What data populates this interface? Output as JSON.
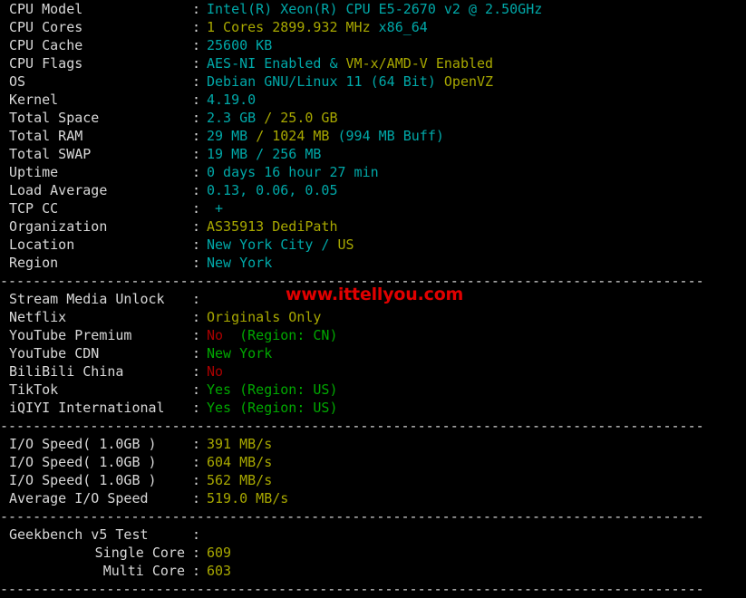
{
  "terminal": {
    "background_color": "#000000",
    "label_color": "#d8d8d8",
    "cyan": "#00a8a8",
    "yellow": "#a8a800",
    "green": "#00a800",
    "red": "#a80000",
    "separator": "--------------------------------------------------------------------------------------"
  },
  "watermark": {
    "text": "www.ittellyou.com",
    "color": "#e00000"
  },
  "system": {
    "rows": [
      {
        "label": "CPU Model",
        "colon": ":",
        "parts": [
          {
            "text": "Intel(R) Xeon(R) CPU E5-2670 v2 @ 2.50GHz",
            "color": "cyan"
          }
        ]
      },
      {
        "label": "CPU Cores",
        "colon": ":",
        "parts": [
          {
            "text": "1 Cores 2899.932 MHz ",
            "color": "yellow"
          },
          {
            "text": "x86_64",
            "color": "cyan"
          }
        ]
      },
      {
        "label": "CPU Cache",
        "colon": ":",
        "parts": [
          {
            "text": "25600 KB",
            "color": "cyan"
          }
        ]
      },
      {
        "label": "CPU Flags",
        "colon": ":",
        "parts": [
          {
            "text": "AES-NI Enabled",
            "color": "cyan"
          },
          {
            "text": " & ",
            "color": "cyan"
          },
          {
            "text": "VM-x/AMD-V Enabled",
            "color": "yellow"
          }
        ]
      },
      {
        "label": "OS",
        "colon": ":",
        "parts": [
          {
            "text": "Debian GNU/Linux 11 (64 Bit) ",
            "color": "cyan"
          },
          {
            "text": "OpenVZ",
            "color": "yellow"
          }
        ]
      },
      {
        "label": "Kernel",
        "colon": ":",
        "parts": [
          {
            "text": "4.19.0",
            "color": "cyan"
          }
        ]
      },
      {
        "label": "Total Space",
        "colon": ":",
        "parts": [
          {
            "text": "2.3 GB ",
            "color": "cyan"
          },
          {
            "text": "/ 25.0 GB",
            "color": "yellow"
          }
        ]
      },
      {
        "label": "Total RAM",
        "colon": ":",
        "parts": [
          {
            "text": "29 MB ",
            "color": "cyan"
          },
          {
            "text": "/ 1024 MB ",
            "color": "yellow"
          },
          {
            "text": "(994 MB Buff)",
            "color": "cyan"
          }
        ]
      },
      {
        "label": "Total SWAP",
        "colon": ":",
        "parts": [
          {
            "text": "19 MB / 256 MB",
            "color": "cyan"
          }
        ]
      },
      {
        "label": "Uptime",
        "colon": ":",
        "parts": [
          {
            "text": "0 days 16 hour 27 min",
            "color": "cyan"
          }
        ]
      },
      {
        "label": "Load Average",
        "colon": ":",
        "parts": [
          {
            "text": "0.13, 0.06, 0.05",
            "color": "cyan"
          }
        ]
      },
      {
        "label": "TCP CC",
        "colon": ":",
        "parts": [
          {
            "text": " +",
            "color": "cyan"
          }
        ]
      },
      {
        "label": "Organization",
        "colon": ":",
        "parts": [
          {
            "text": "AS35913 DediPath",
            "color": "yellow"
          }
        ]
      },
      {
        "label": "Location",
        "colon": ":",
        "parts": [
          {
            "text": "New York City / ",
            "color": "cyan"
          },
          {
            "text": "US",
            "color": "yellow"
          }
        ]
      },
      {
        "label": "Region",
        "colon": ":",
        "parts": [
          {
            "text": "New York",
            "color": "cyan"
          }
        ]
      }
    ]
  },
  "stream_media": {
    "rows": [
      {
        "label": "Stream Media Unlock",
        "colon": ":",
        "parts": []
      },
      {
        "label": "Netflix",
        "colon": ":",
        "parts": [
          {
            "text": "Originals Only",
            "color": "yellow"
          }
        ]
      },
      {
        "label": "YouTube Premium",
        "colon": ":",
        "parts": [
          {
            "text": "No",
            "color": "red"
          },
          {
            "text": "  (Region: CN)",
            "color": "green"
          }
        ]
      },
      {
        "label": "YouTube CDN",
        "colon": ":",
        "parts": [
          {
            "text": "New York",
            "color": "green"
          }
        ]
      },
      {
        "label": "BiliBili China",
        "colon": ":",
        "parts": [
          {
            "text": "No",
            "color": "red"
          }
        ]
      },
      {
        "label": "TikTok",
        "colon": ":",
        "parts": [
          {
            "text": "Yes (Region: US)",
            "color": "green"
          }
        ]
      },
      {
        "label": "iQIYI International",
        "colon": ":",
        "parts": [
          {
            "text": "Yes (Region: US)",
            "color": "green"
          }
        ]
      }
    ]
  },
  "io_speed": {
    "rows": [
      {
        "label": "I/O Speed( 1.0GB )",
        "colon": ":",
        "parts": [
          {
            "text": "391 MB/s",
            "color": "yellow"
          }
        ]
      },
      {
        "label": "I/O Speed( 1.0GB )",
        "colon": ":",
        "parts": [
          {
            "text": "604 MB/s",
            "color": "yellow"
          }
        ]
      },
      {
        "label": "I/O Speed( 1.0GB )",
        "colon": ":",
        "parts": [
          {
            "text": "562 MB/s",
            "color": "yellow"
          }
        ]
      },
      {
        "label": "Average I/O Speed",
        "colon": ":",
        "parts": [
          {
            "text": "519.0 MB/s",
            "color": "yellow"
          }
        ]
      }
    ]
  },
  "geekbench": {
    "rows": [
      {
        "label": "Geekbench v5 Test",
        "colon": ":",
        "indent": false,
        "parts": []
      },
      {
        "label": "Single Core",
        "colon": ":",
        "indent": true,
        "parts": [
          {
            "text": "609",
            "color": "yellow"
          }
        ]
      },
      {
        "label": "Multi Core",
        "colon": ":",
        "indent": true,
        "parts": [
          {
            "text": "603",
            "color": "yellow"
          }
        ]
      }
    ]
  }
}
